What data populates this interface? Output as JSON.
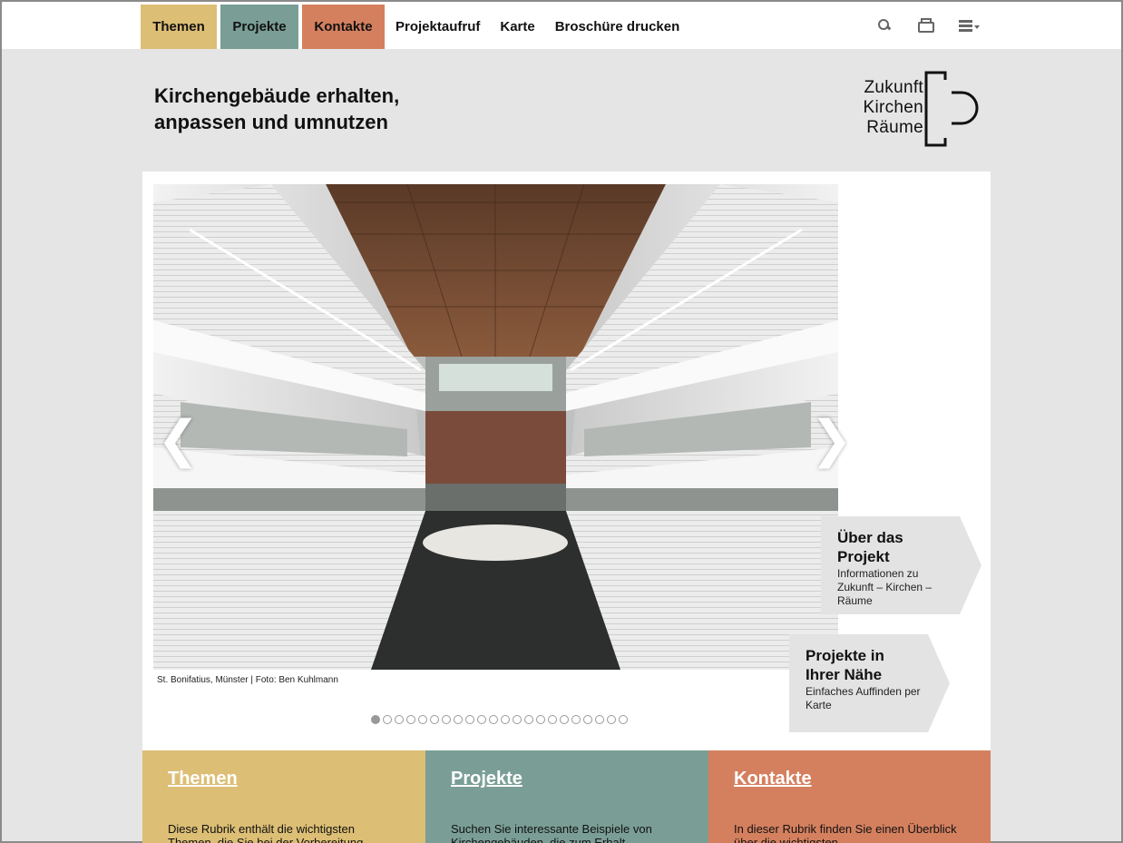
{
  "nav": {
    "items": [
      {
        "label": "Themen",
        "color": "#dcbe75"
      },
      {
        "label": "Projekte",
        "color": "#7a9e95"
      },
      {
        "label": "Kontakte",
        "color": "#d4805f"
      },
      {
        "label": "Projektaufruf"
      },
      {
        "label": "Karte"
      },
      {
        "label": "Broschüre drucken"
      }
    ],
    "tools": [
      "search-icon",
      "print-icon",
      "menu-icon"
    ]
  },
  "header": {
    "headline_line1": "Kirchengebäude erhalten,",
    "headline_line2": "anpassen und umnutzen",
    "logo_lines": [
      "Zukunft",
      "Kirchen",
      "Räume"
    ]
  },
  "slider": {
    "caption": "St. Bonifatius, Münster | Foto: Ben Kuhlmann",
    "prev_symbol": "❮",
    "next_symbol": "❯",
    "dot_count": 22,
    "active_dot": 1
  },
  "teasers": [
    {
      "title": "Über das Projekt",
      "text": "Informationen zu Zukunft – Kirchen – Räume"
    },
    {
      "title": "Projekte in Ihrer Nähe",
      "text": "Einfaches Auffinden per Karte"
    }
  ],
  "columns": [
    {
      "title": "Themen",
      "text": "Diese Rubrik enthält die wichtigsten Themen, die Sie bei der Vorbereitung",
      "color": "#dcbe75"
    },
    {
      "title": "Projekte",
      "text": "Suchen Sie interessante Beispiele von Kirchengebäuden, die zum Erhalt",
      "color": "#7a9e95"
    },
    {
      "title": "Kontakte",
      "text": "In dieser Rubrik finden Sie einen Überblick über die wichtigsten",
      "color": "#d4805f"
    }
  ]
}
